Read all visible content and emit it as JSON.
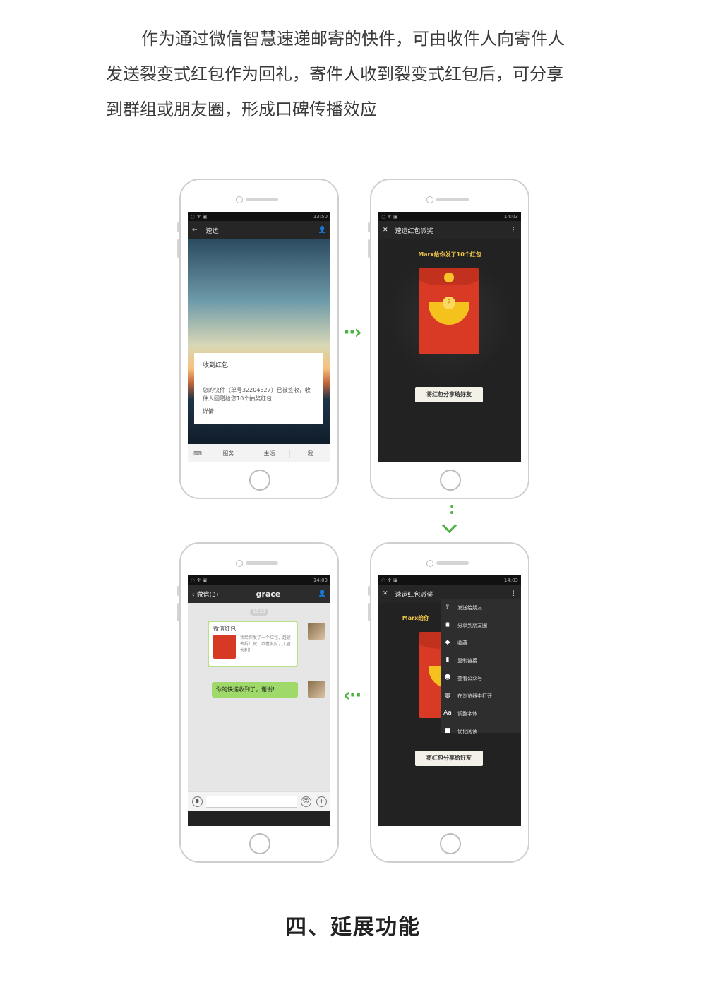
{
  "intro": {
    "line1": "作为通过微信智慧速递邮寄的快件，可由收件人向寄件人",
    "line2": "发送裂变式红包作为回礼，寄件人收到裂变式红包后，可分享",
    "line3": "到群组或朋友圈，形成口碑传播效应"
  },
  "phone1": {
    "status_time": "13:50",
    "title": "速运",
    "notify_title": "收到红包",
    "notify_body": "您的快件（单号32204327）已被签收，收件人回赠给您10个抽奖红包",
    "notify_link": "详情",
    "menu": [
      "服务",
      "生活",
      "我"
    ]
  },
  "phone2": {
    "status_time": "14:03",
    "title": "速运红包派奖",
    "header": "Marx给你发了10个红包",
    "share_button": "将红包分享给好友"
  },
  "phone3": {
    "status_time": "14:03",
    "back_label": "微信(3)",
    "title": "grace",
    "time_pill": "17:23",
    "card_title": "微信红包",
    "card_message": "我给你发了一个红包，赶紧去拆！祝：恭喜发财，大吉大利！",
    "bubble": "你的快递收到了，谢谢!"
  },
  "phone4": {
    "status_time": "14:03",
    "title": "速运红包派奖",
    "header": "Marx给你",
    "share_button": "将红包分享给好友",
    "menu": [
      {
        "icon": "share-icon",
        "glyph": "⇪",
        "label": "发送给朋友"
      },
      {
        "icon": "moments-icon",
        "glyph": "◉",
        "label": "分享到朋友圈"
      },
      {
        "icon": "favorite-icon",
        "glyph": "◆",
        "label": "收藏"
      },
      {
        "icon": "link-icon",
        "glyph": "▮",
        "label": "复制链接"
      },
      {
        "icon": "account-icon",
        "glyph": "☻",
        "label": "查看公众号"
      },
      {
        "icon": "browser-icon",
        "glyph": "◍",
        "label": "在浏览器中打开"
      },
      {
        "icon": "font-icon",
        "glyph": "Aa",
        "label": "调整字体"
      },
      {
        "icon": "report-icon",
        "glyph": "■",
        "label": "优化阅读"
      }
    ]
  },
  "section_title": "四、延展功能",
  "colors": {
    "accent_green": "#4fb043",
    "packet_red": "#d83a25"
  }
}
